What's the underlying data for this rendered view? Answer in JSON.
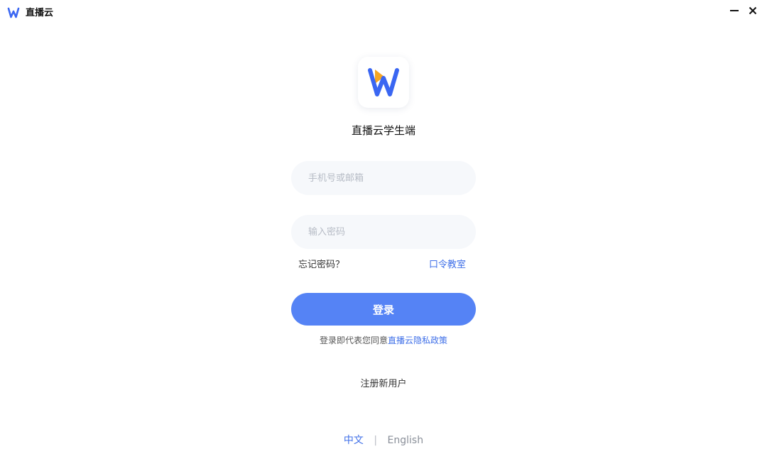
{
  "window": {
    "title": "直播云",
    "minimize_icon": "minimize-icon",
    "close_icon": "close-icon"
  },
  "brand": {
    "logo_icon": "w-play-logo-icon",
    "app_name": "直播云学生端",
    "colors": {
      "blue": "#3a66f2",
      "orange": "#f5a623"
    }
  },
  "form": {
    "phone_placeholder": "手机号或邮箱",
    "phone_value": "",
    "password_placeholder": "输入密码",
    "password_value": "",
    "forgot_label": "忘记密码？",
    "classroom_label": "口令教室",
    "login_label": "登录"
  },
  "agreement": {
    "prefix": "登录即代表您同意",
    "policy_link": "直播云隐私政策"
  },
  "register_label": "注册新用户",
  "language": {
    "zh": "中文",
    "separator": "|",
    "en": "English",
    "selected": "中文"
  },
  "colors": {
    "accent": "#5583f5",
    "link": "#3f6fe8",
    "input_bg": "#f6f8fb"
  }
}
